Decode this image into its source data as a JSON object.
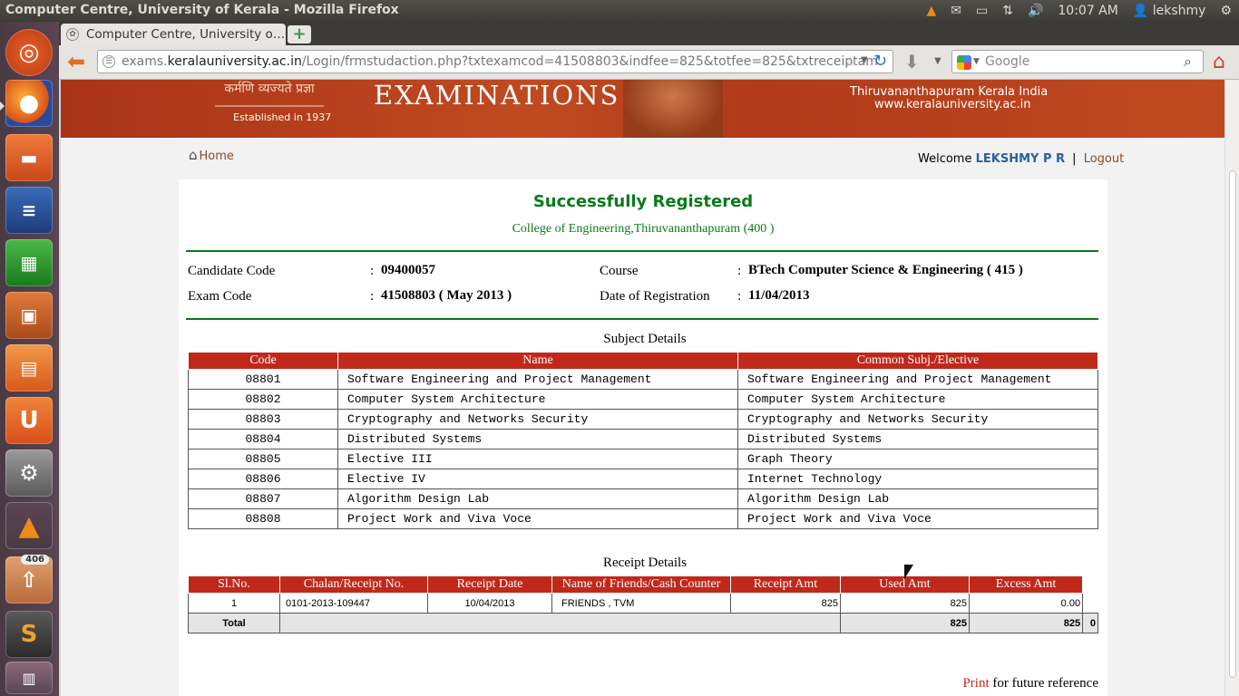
{
  "topbar": {
    "window_title": "Computer Centre, University of Kerala - Mozilla Firefox",
    "time": "10:07 AM",
    "user": "lekshmy"
  },
  "launcher": {
    "items": [
      "ubuntu-dash",
      "firefox",
      "files",
      "writer",
      "calc",
      "impress",
      "software-center",
      "ubuntu-one",
      "system-settings",
      "vlc",
      "update-manager",
      "sublime-text",
      "workspaces"
    ],
    "update_badge": "406"
  },
  "browser": {
    "tab_title": "Computer Centre, University o…",
    "url_prefix": "exams.",
    "url_domain": "keralauniversity.ac.in",
    "url_path": "/Login/frmstudaction.php?txtexamcod=41508803&indfee=825&totfee=825&txtreceiptam",
    "search_placeholder": "Google"
  },
  "banner": {
    "motto": "कर्मणि व्यज्यते प्रज्ञा",
    "established": "Established in 1937",
    "heading": "EXAMINATIONS",
    "place": "Thiruvananthapuram  Kerala  India",
    "website": "www.keralauniversity.ac.in"
  },
  "nav": {
    "home_label": "Home",
    "welcome_label": "Welcome",
    "user_name": "LEKSHMY P R",
    "separator": "|",
    "logout_label": "Logout"
  },
  "registration": {
    "status": "Successfully Registered",
    "college": "College of Engineering,Thiruvananthapuram (400 )",
    "candidate_code_label": "Candidate Code",
    "candidate_code": "09400057",
    "exam_code_label": "Exam Code",
    "exam_code": "41508803 ( May 2013 )",
    "course_label": "Course",
    "course": "BTech Computer Science & Engineering ( 415 )",
    "date_label": "Date of Registration",
    "date": "11/04/2013",
    "colon": ":"
  },
  "subjects": {
    "title": "Subject Details",
    "headers": [
      "Code",
      "Name",
      "Common Subj./Elective"
    ],
    "rows": [
      [
        "08801",
        "Software Engineering and Project Management",
        "Software Engineering and Project Management"
      ],
      [
        "08802",
        "Computer System Architecture",
        "Computer System Architecture"
      ],
      [
        "08803",
        "Cryptography and Networks Security",
        "Cryptography and Networks Security"
      ],
      [
        "08804",
        "Distributed Systems",
        "Distributed Systems"
      ],
      [
        "08805",
        "Elective III",
        "Graph Theory"
      ],
      [
        "08806",
        "Elective IV",
        "Internet Technology"
      ],
      [
        "08807",
        "Algorithm Design Lab",
        "Algorithm Design Lab"
      ],
      [
        "08808",
        "Project Work and Viva Voce",
        "Project Work and Viva Voce"
      ]
    ]
  },
  "receipts": {
    "title": "Receipt Details",
    "headers": [
      "Sl.No.",
      "Chalan/Receipt No.",
      "Receipt Date",
      "Name of Friends/Cash Counter",
      "Receipt Amt",
      "Used Amt",
      "Excess Amt"
    ],
    "rows": [
      [
        "1",
        "0101-2013-109447",
        "10/04/2013",
        "FRIENDS , TVM",
        "825",
        "825",
        "0.00"
      ]
    ],
    "total_label": "Total",
    "total_receipt": "825",
    "total_used": "825",
    "total_excess": "0"
  },
  "footer": {
    "print_label": "Print",
    "print_suffix": " for future reference"
  }
}
